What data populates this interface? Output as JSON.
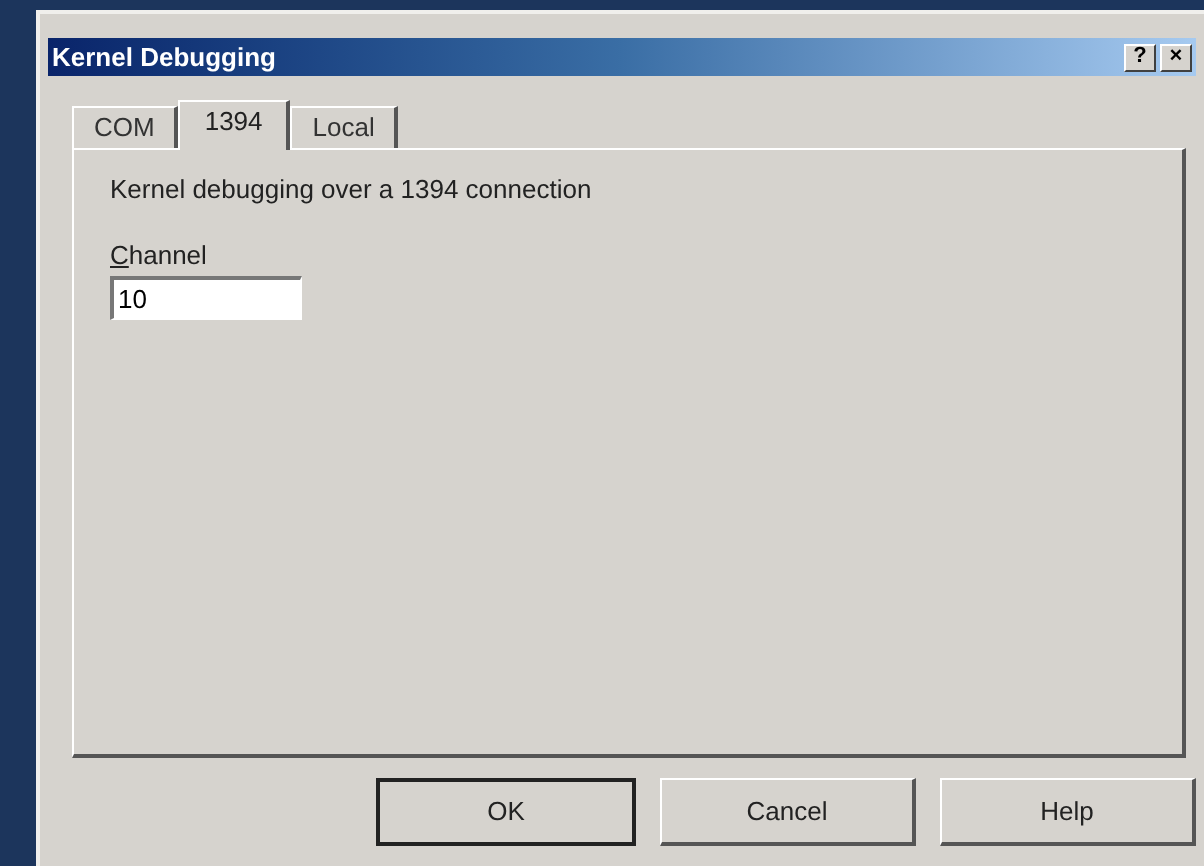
{
  "window": {
    "title": "Kernel Debugging",
    "title_buttons": [
      "?",
      "×"
    ]
  },
  "tabs": [
    {
      "label": "COM",
      "selected": false
    },
    {
      "label": "1394",
      "selected": true
    },
    {
      "label": "Local",
      "selected": false
    }
  ],
  "panel": {
    "description": "Kernel debugging over a 1394 connection",
    "field": {
      "label": "Channel",
      "value": "10"
    }
  },
  "buttons": [
    {
      "label": "OK",
      "default": true
    },
    {
      "label": "Cancel",
      "default": false
    },
    {
      "label": "Help",
      "default": false
    }
  ]
}
